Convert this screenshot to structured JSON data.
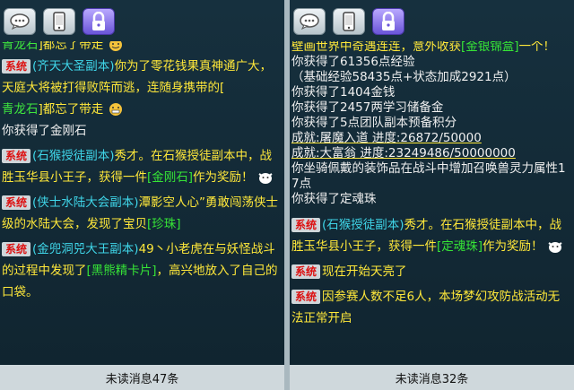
{
  "left": {
    "lines": {
      "l1_a": "青龙石",
      "l1_b": "]都忘了带走",
      "l2_tag": "系统",
      "l2_a": "(齐天大圣副本)",
      "l2_b": "你为了零花钱果真神通广大，天庭大将被打得败阵而逃，连随身携带的[",
      "l3_a": "青龙石",
      "l3_b": "]都忘了带走",
      "l4": "你获得了金刚石",
      "l5_tag": "系统",
      "l5_a": "(石猴授徒副本)",
      "l5_b": "秀才。在石猴授徒副本中，战胜玉华县小王子，获得一件",
      "l5_link": "[金刚石]",
      "l5_c": "作为奖励！",
      "l6_tag": "系统",
      "l6_a": "(侠士水陆大会副本)",
      "l6_b": "潭影空人心”勇敢闯荡侠士级的水陆大会，发现了宝贝",
      "l6_link": "[珍珠]",
      "l7_tag": "系统",
      "l7_a": "(金兜洞兕大王副本)",
      "l7_b": "49丶小老虎在与妖怪战斗的过程中发现了",
      "l7_link": "[黑熊精卡片]",
      "l7_c": "，高兴地放入了自己的口袋。"
    },
    "footer": "未读消息47条"
  },
  "right": {
    "lines": {
      "r0_a": "壁画世界中奇遇连连，意外收获",
      "r0_link": "[金银锦盒]",
      "r0_b": "一个！",
      "r1": "你获得了61356点经验",
      "r2": "（基础经验58435点+状态加成2921点）",
      "r3": "你获得了1404金钱",
      "r4": "你获得了2457两学习储备金",
      "r5": "你获得了5点团队副本预备积分",
      "r6": "成就:屠魔入道  进度:26872/50000",
      "r7": "成就:大富翁  进度:23249486/50000000",
      "r8": "你坐骑佩戴的装饰品在战斗中增加召唤兽灵力属性17点",
      "r9": "你获得了定魂珠",
      "r10_tag": "系统",
      "r10_a": "(石猴授徒副本)",
      "r10_b": "秀才。在石猴授徒副本中，战胜玉华县小王子，获得一件",
      "r10_link": "[定魂珠]",
      "r10_c": "作为奖励！",
      "r11_tag": "系统",
      "r11_a": "现在开始天亮了",
      "r12_tag": "系统",
      "r12_a": "因参赛人数不足6人，本场梦幻攻防战活动无法正常开启"
    },
    "footer": "未读消息32条"
  },
  "icons": {
    "chat": "chat-bubble-icon",
    "phone": "phone-icon",
    "lock": "lock-icon"
  }
}
